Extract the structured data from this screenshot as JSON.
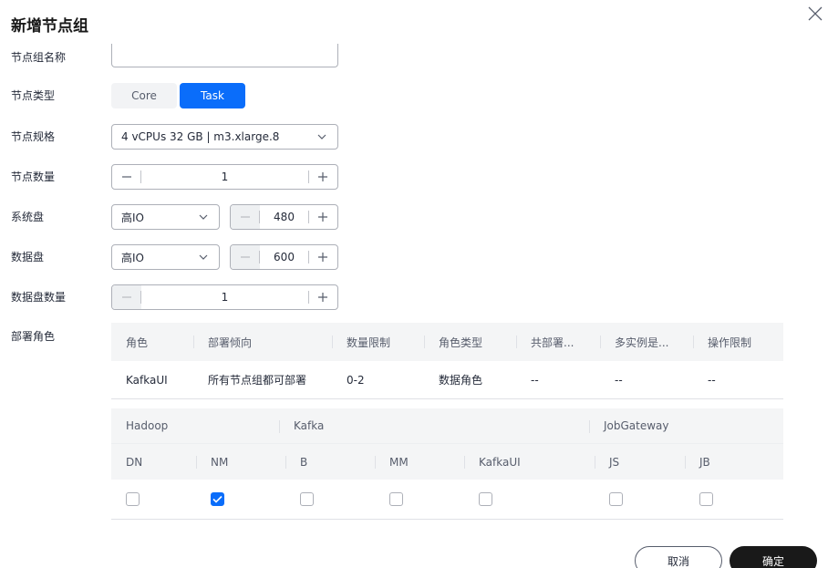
{
  "dialog": {
    "title": "新增节点组",
    "close_icon": "close-icon"
  },
  "form": {
    "name_label": "节点组名称",
    "name_value": "",
    "type_label": "节点类型",
    "type_options": [
      "Core",
      "Task"
    ],
    "type_selected": "Task",
    "spec_label": "节点规格",
    "spec_value": "4 vCPUs 32 GB | m3.xlarge.8",
    "count_label": "节点数量",
    "count_value": "1",
    "sysdisk_label": "系统盘",
    "sysdisk_type": "高IO",
    "sysdisk_size": "480",
    "datadisk_label": "数据盘",
    "datadisk_type": "高IO",
    "datadisk_size": "600",
    "datadisk_count_label": "数据盘数量",
    "datadisk_count_value": "1",
    "role_label": "部署角色"
  },
  "role_table": {
    "headers": [
      "角色",
      "部署倾向",
      "数量限制",
      "角色类型",
      "共部署...",
      "多实例是...",
      "操作限制"
    ],
    "rows": [
      [
        "KafkaUI",
        "所有节点组都可部署",
        "0-2",
        "数据角色",
        "--",
        "--",
        "--"
      ]
    ]
  },
  "role_grid": {
    "groups": [
      "Hadoop",
      "Kafka",
      "JobGateway"
    ],
    "roles": [
      {
        "name": "DN",
        "checked": false
      },
      {
        "name": "NM",
        "checked": true
      },
      {
        "name": "B",
        "checked": false
      },
      {
        "name": "MM",
        "checked": false
      },
      {
        "name": "KafkaUI",
        "checked": false
      },
      {
        "name": "JS",
        "checked": false
      },
      {
        "name": "JB",
        "checked": false
      }
    ]
  },
  "footer": {
    "cancel_label": "取消",
    "ok_label": "确定"
  },
  "colors": {
    "accent": "#0a6dfa",
    "primary_button": "#191919"
  }
}
